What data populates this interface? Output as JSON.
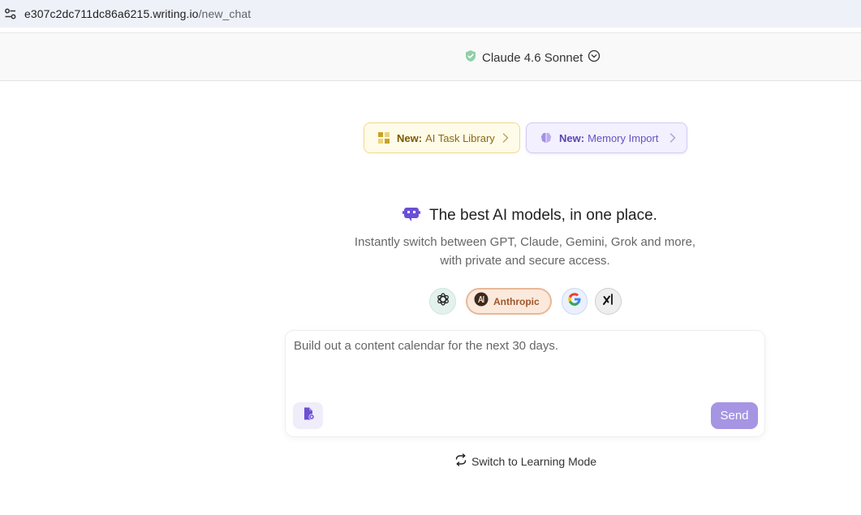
{
  "browser": {
    "url_host": "e307c2dc711dc86a6215.writing.io",
    "url_path": "/new_chat"
  },
  "header": {
    "model_name": "Claude 4.6 Sonnet"
  },
  "announcements": [
    {
      "bold": "New:",
      "text": "AI Task Library"
    },
    {
      "bold": "New:",
      "text": "Memory Import"
    }
  ],
  "hero": {
    "title": "The best AI models, in one place.",
    "subtitle_line1": "Instantly switch between GPT, Claude, Gemini, Grok and more,",
    "subtitle_line2": "with private and secure access."
  },
  "providers": [
    {
      "name": "",
      "icon": "openai-icon"
    },
    {
      "name": "Anthropic",
      "icon": "anthropic-icon",
      "selected": true
    },
    {
      "name": "",
      "icon": "google-icon"
    },
    {
      "name": "",
      "icon": "xai-icon"
    }
  ],
  "composer": {
    "placeholder": "Build out a content calendar for the next 30 days.",
    "send_label": "Send"
  },
  "footer": {
    "learning_mode_label": "Switch to Learning Mode"
  },
  "colors": {
    "accent": "#a695e3",
    "anthropic_chip": "#fbe9dc",
    "task_pill": "#fffbe9",
    "memory_pill": "#f3f0ff"
  }
}
